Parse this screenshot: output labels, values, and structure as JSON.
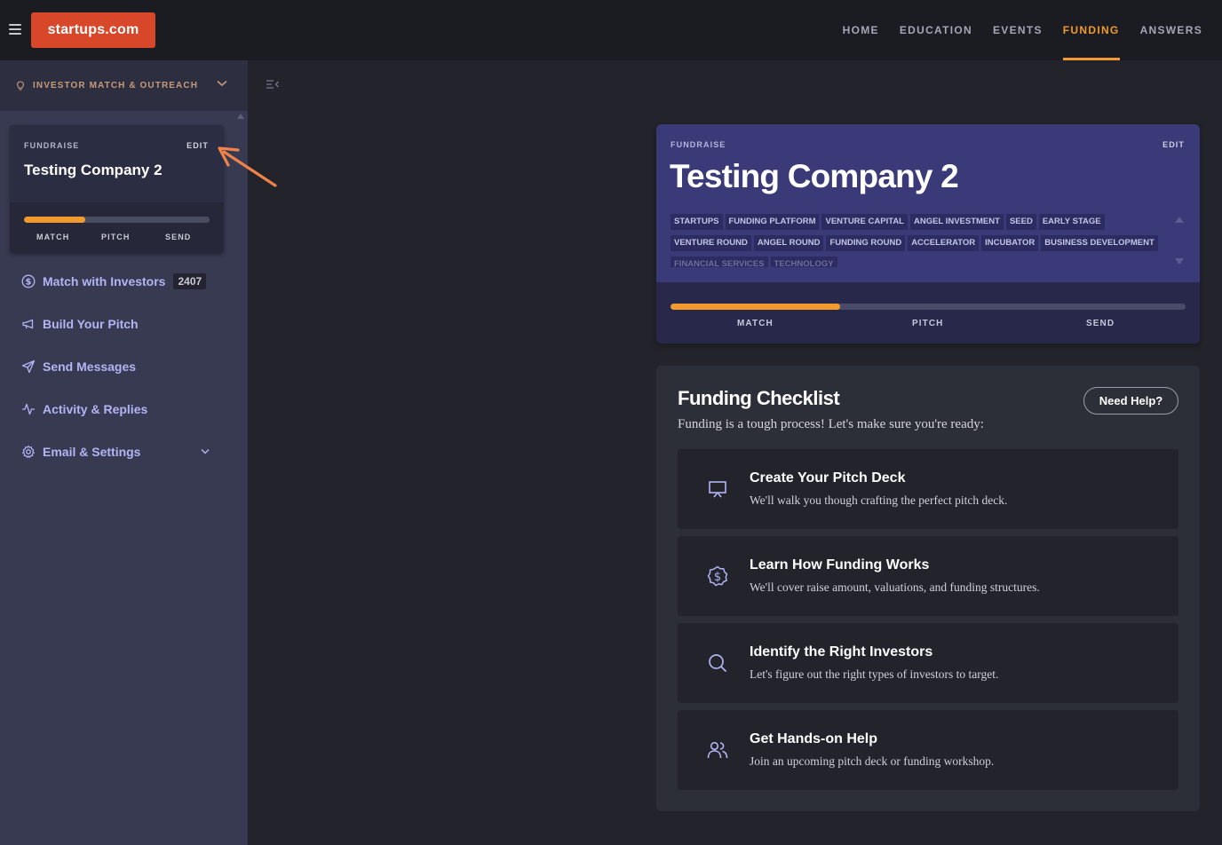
{
  "logo": "startups.com",
  "nav": [
    {
      "label": "HOME",
      "active": false
    },
    {
      "label": "EDUCATION",
      "active": false
    },
    {
      "label": "EVENTS",
      "active": false
    },
    {
      "label": "FUNDING",
      "active": true
    },
    {
      "label": "ANSWERS",
      "active": false
    }
  ],
  "sidebar": {
    "section_title": "INVESTOR MATCH & OUTREACH",
    "fundraise": {
      "label": "FUNDRAISE",
      "edit": "EDIT",
      "company": "Testing Company 2",
      "progress": 0.33,
      "steps": [
        "MATCH",
        "PITCH",
        "SEND"
      ]
    },
    "items": [
      {
        "label": "Match with Investors",
        "badge": "2407",
        "icon": "dollar-circle-icon"
      },
      {
        "label": "Build Your Pitch",
        "icon": "megaphone-icon"
      },
      {
        "label": "Send Messages",
        "icon": "send-icon"
      },
      {
        "label": "Activity & Replies",
        "icon": "activity-icon"
      },
      {
        "label": "Email & Settings",
        "icon": "gear-icon"
      }
    ]
  },
  "fundraise_main": {
    "label": "FUNDRAISE",
    "edit": "EDIT",
    "company": "Testing Company 2",
    "tags": [
      "STARTUPS",
      "FUNDING PLATFORM",
      "VENTURE CAPITAL",
      "ANGEL INVESTMENT",
      "SEED",
      "EARLY STAGE",
      "VENTURE ROUND",
      "ANGEL ROUND",
      "FUNDING ROUND",
      "ACCELERATOR",
      "INCUBATOR",
      "BUSINESS DEVELOPMENT",
      "FINANCIAL SERVICES",
      "TECHNOLOGY"
    ],
    "progress": 0.33,
    "steps": [
      "MATCH",
      "PITCH",
      "SEND"
    ]
  },
  "checklist": {
    "title": "Funding Checklist",
    "subtitle": "Funding is a tough process! Let's make sure you're ready:",
    "help_button": "Need Help?",
    "items": [
      {
        "title": "Create Your Pitch Deck",
        "desc": "We'll walk you though crafting the perfect pitch deck.",
        "icon": "presentation-icon"
      },
      {
        "title": "Learn How Funding Works",
        "desc": "We'll cover raise amount, valuations, and funding structures.",
        "icon": "dollar-badge-icon"
      },
      {
        "title": "Identify the Right Investors",
        "desc": "Let's figure out the right types of investors to target.",
        "icon": "search-icon"
      },
      {
        "title": "Get Hands-on Help",
        "desc": "Join an upcoming pitch deck or funding workshop.",
        "icon": "users-icon"
      }
    ]
  },
  "colors": {
    "accent": "#f29a2e",
    "brand": "#d9472b",
    "sidebar_link": "#b3b4f4"
  }
}
